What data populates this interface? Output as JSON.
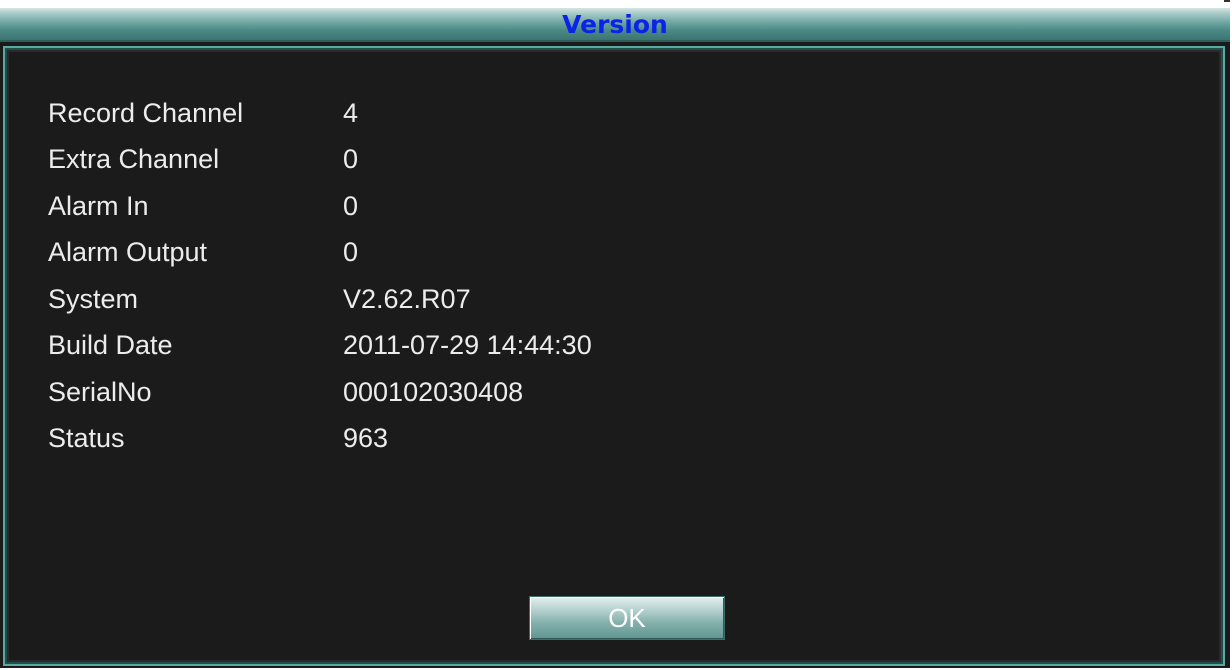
{
  "dialog": {
    "title": "Version",
    "title_color": "#0b22e8",
    "border_color": "#5aa9a3",
    "background_color": "#1b1b1b"
  },
  "info": [
    {
      "label": "Record Channel",
      "value": "4"
    },
    {
      "label": "Extra Channel",
      "value": "0"
    },
    {
      "label": "Alarm In",
      "value": "0"
    },
    {
      "label": "Alarm Output",
      "value": "0"
    },
    {
      "label": "System",
      "value": "V2.62.R07"
    },
    {
      "label": "Build Date",
      "value": "2011-07-29 14:44:30"
    },
    {
      "label": "SerialNo",
      "value": "000102030408"
    },
    {
      "label": "Status",
      "value": "963"
    }
  ],
  "buttons": {
    "ok_label": "OK"
  }
}
